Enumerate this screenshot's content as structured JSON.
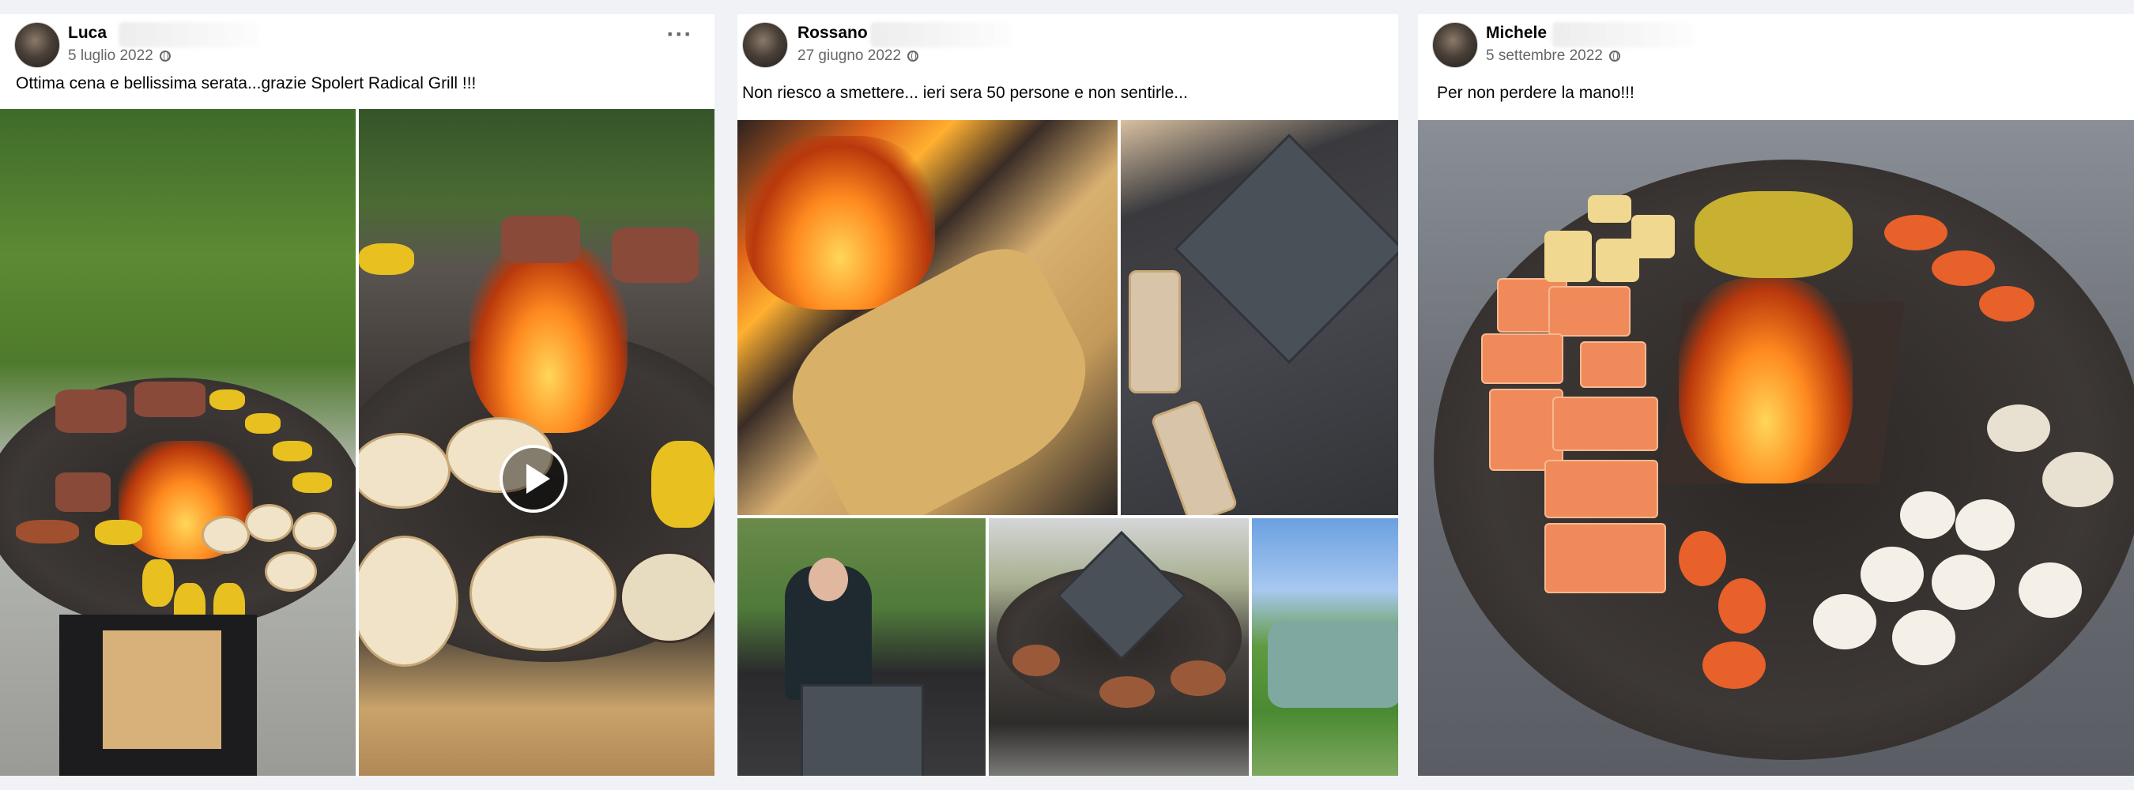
{
  "posts": [
    {
      "author": "Luca",
      "date": "5 luglio 2022",
      "caption": "Ottima cena e bellissima serata...grazie Spolert Radical Grill !!!",
      "more_label": "···"
    },
    {
      "author": "Rossano",
      "date": "27 giugno 2022",
      "caption": "Non riesco a smettere... ieri sera 50 persone e non sentirle..."
    },
    {
      "author": "Michele",
      "date": "5 settembre 2022",
      "caption": "Per non perdere la mano!!!"
    }
  ],
  "icons": {
    "privacy": "globe-icon",
    "options": "more-options-icon",
    "video": "play-icon"
  },
  "colors": {
    "background": "#f0f2f5",
    "card": "#ffffff",
    "text_primary": "#050505",
    "text_secondary": "#65676b"
  }
}
